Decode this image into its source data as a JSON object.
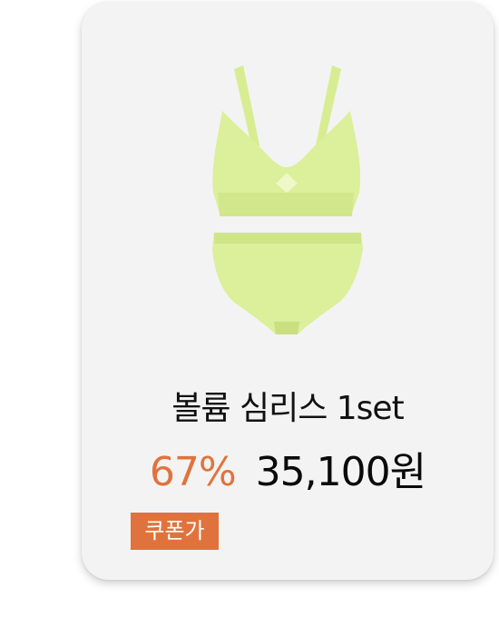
{
  "product": {
    "name": "볼륨 심리스 1set",
    "discount": "67%",
    "price": "35,100원",
    "coupon_label": "쿠폰가"
  },
  "colors": {
    "card_background": "#f3f3f3",
    "discount": "#e0733d",
    "badge_background": "#e0733d",
    "product_fabric": "#dcef9a"
  },
  "icons": {
    "image": "product-photo-bra-set"
  }
}
